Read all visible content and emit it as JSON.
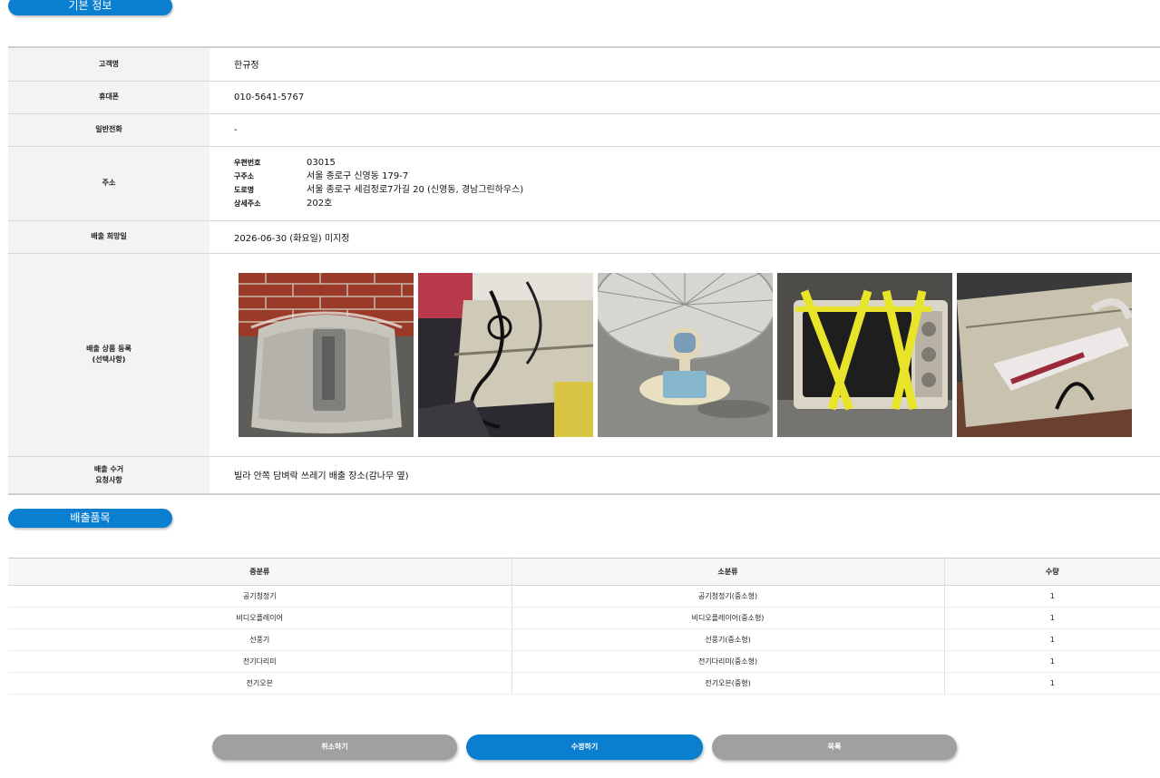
{
  "sections": {
    "basic_info_title": "기본 정보",
    "items_title": "배출품목"
  },
  "info": {
    "customer_label": "고객명",
    "customer_value": "한규정",
    "mobile_label": "휴대폰",
    "mobile_value": "010-5641-5767",
    "phone_label": "일반전화",
    "phone_value": "-",
    "address_label": "주소",
    "address": {
      "postcode_label": "우편번호",
      "postcode_value": "03015",
      "old_label": "구주소",
      "old_value": "서울 종로구 신영동 179-7",
      "road_label": "도로명",
      "road_value": "서울 종로구 세검정로7가길 20 (신영동, 경남그린하우스)",
      "detail_label": "상세주소",
      "detail_value": "202호"
    },
    "date_label": "배출 희망일",
    "date_value": "2026-06-30 (화요일) 미지정",
    "photos_label_line1": "배출 상품 등록",
    "photos_label_line2": "(선택사항)",
    "photos": [
      "air-purifier-photo",
      "video-player-photo",
      "electric-fan-photo",
      "toaster-oven-photo",
      "electric-iron-photo"
    ],
    "request_label_line1": "배출 수거",
    "request_label_line2": "요청사항",
    "request_value": "빌라 안쪽 담벼락 쓰레기 배출 장소(감나무 옆)"
  },
  "items_table": {
    "headers": [
      "중분류",
      "소분류",
      "수량"
    ],
    "rows": [
      [
        "공기청정기",
        "공기청정기(중소형)",
        "1"
      ],
      [
        "비디오플레이어",
        "비디오플레이어(중소형)",
        "1"
      ],
      [
        "선풍기",
        "선풍기(중소형)",
        "1"
      ],
      [
        "전기다리미",
        "전기다리미(중소형)",
        "1"
      ],
      [
        "전기오븐",
        "전기오븐(중형)",
        "1"
      ]
    ]
  },
  "buttons": {
    "cancel": "취소하기",
    "edit": "수정하기",
    "list": "목록"
  },
  "colors": {
    "accent": "#0a7fd0",
    "button_gray": "#a0a0a0",
    "label_bg": "#f3f3f3"
  }
}
